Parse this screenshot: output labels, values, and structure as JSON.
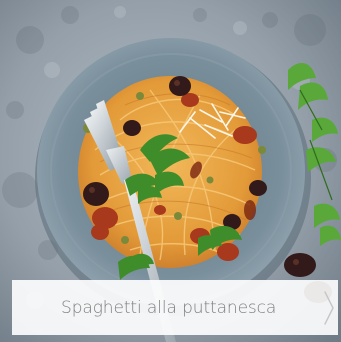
{
  "image": {
    "subject": "spaghetti-puttanesca-plate",
    "colors": {
      "background": "#9aa4ae",
      "plate": "#7f94a2",
      "pasta": "#e8a23d",
      "sauce": "#b3421f",
      "parsley": "#3d8a2a",
      "olive": "#3a1f1a"
    }
  },
  "caption": {
    "title": "Spaghetti alla puttanesca",
    "next_icon": "chevron-right-icon"
  }
}
